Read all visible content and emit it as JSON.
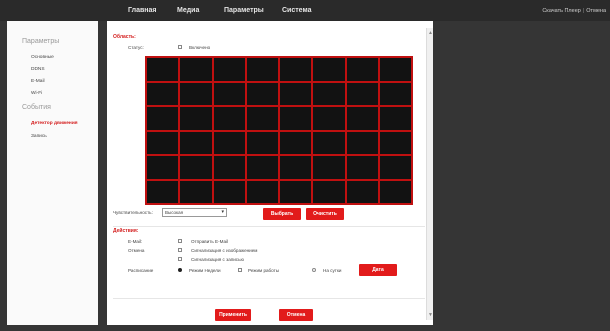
{
  "nav": {
    "items": [
      "Главная",
      "Медиа",
      "Параметры",
      "Система"
    ]
  },
  "topright": {
    "download": "Скачать Плеер",
    "separator": "|",
    "exit": "Отмена"
  },
  "sidebar": {
    "section1": "Параметры",
    "items1": [
      "Основные",
      "DDNS",
      "E-Mail",
      "Wi-Fi"
    ],
    "section2": "События",
    "items2": [
      "Детектор движения",
      "Запись"
    ],
    "active": "Детектор движения"
  },
  "area": {
    "title": "Область:",
    "status_label": "Статус:",
    "status_option": "Включено",
    "grid_cols": 8,
    "grid_rows": 6,
    "sensitivity_label": "Чувствительность:",
    "sensitivity_value": "Высокая",
    "select_button": "Выбрать",
    "clear_button": "Очистить"
  },
  "actions": {
    "title": "Действия:",
    "email_label": "E-Mail:",
    "email_option": "Отправить E-Mail",
    "notify_label": "Отмена",
    "notify_option1": "Сигнализация с изображением",
    "notify_option2": "Сигнализация с записью",
    "schedule_label": "Расписание",
    "schedule_opt1": "Режим Недели",
    "schedule_opt2": "Режим работы",
    "schedule_opt3": "На сутки",
    "date_button": "Дата"
  },
  "footer": {
    "apply": "Применить",
    "cancel": "Отмена"
  },
  "colors": {
    "accent": "#e21b1b",
    "grid_bg": "#121212",
    "background": "#353535"
  }
}
